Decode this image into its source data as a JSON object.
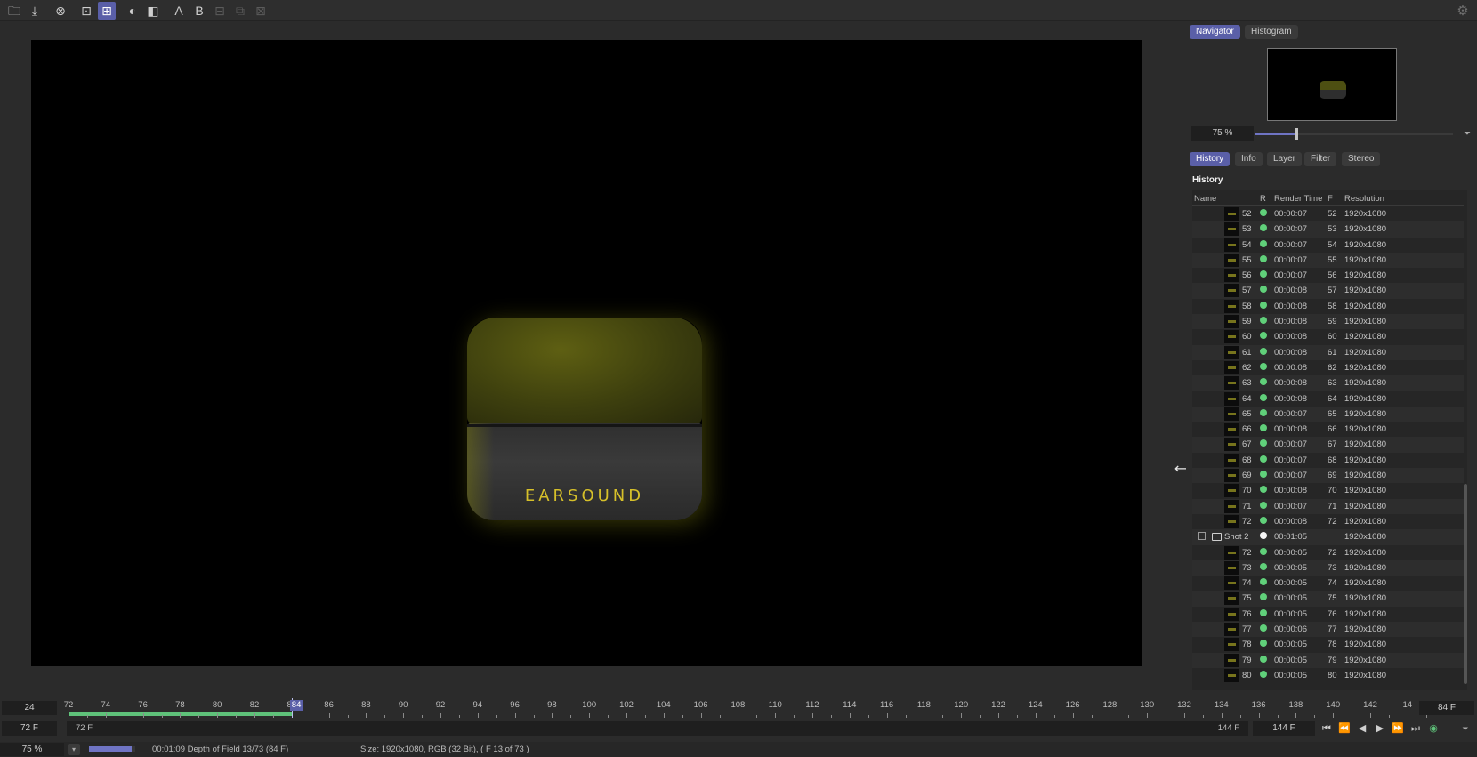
{
  "toolbar": {
    "buttons": [
      {
        "name": "open-folder-icon",
        "glyph": "🗀",
        "active": false,
        "dim": false
      },
      {
        "name": "save-icon",
        "glyph": "⤓",
        "active": false,
        "dim": false
      },
      {
        "name": "close-circle-icon",
        "glyph": "⊗",
        "active": false,
        "dim": false
      },
      {
        "name": "render-region-icon",
        "glyph": "⊡",
        "active": false,
        "dim": false
      },
      {
        "name": "render-active-icon",
        "glyph": "⊞",
        "active": true,
        "dim": false
      },
      {
        "name": "contrast-icon",
        "glyph": "◐",
        "active": false,
        "dim": false
      },
      {
        "name": "ab-compare-icon",
        "glyph": "◧",
        "active": false,
        "dim": false
      },
      {
        "name": "a-letter-icon",
        "glyph": "A",
        "active": false,
        "dim": false
      },
      {
        "name": "b-letter-icon",
        "glyph": "B",
        "active": false,
        "dim": false
      },
      {
        "name": "split-view-icon",
        "glyph": "⊟",
        "active": false,
        "dim": true
      },
      {
        "name": "layer-copy-icon",
        "glyph": "⧉",
        "active": false,
        "dim": true
      },
      {
        "name": "export-icon",
        "glyph": "⊠",
        "active": false,
        "dim": true
      }
    ],
    "settings_glyph": "⚙"
  },
  "viewport": {
    "product_logo": "EARSOUND",
    "cursor_glyph": "⟷"
  },
  "panel": {
    "top_tabs": [
      "Navigator",
      "Histogram"
    ],
    "zoom": "75 %",
    "zoom_fraction": 0.2,
    "zoom_menu_glyph": "⏷",
    "tabs": [
      "History",
      "Info",
      "Layer",
      "Filter",
      "Stereo"
    ],
    "history_title": "History",
    "columns": {
      "name": "Name",
      "r": "R",
      "render_time": "Render Time",
      "f": "F",
      "resolution": "Resolution"
    },
    "rows": [
      {
        "name": "52",
        "time": "00:00:07",
        "f": "52",
        "res": "1920x1080"
      },
      {
        "name": "53",
        "time": "00:00:07",
        "f": "53",
        "res": "1920x1080"
      },
      {
        "name": "54",
        "time": "00:00:07",
        "f": "54",
        "res": "1920x1080"
      },
      {
        "name": "55",
        "time": "00:00:07",
        "f": "55",
        "res": "1920x1080"
      },
      {
        "name": "56",
        "time": "00:00:07",
        "f": "56",
        "res": "1920x1080"
      },
      {
        "name": "57",
        "time": "00:00:08",
        "f": "57",
        "res": "1920x1080"
      },
      {
        "name": "58",
        "time": "00:00:08",
        "f": "58",
        "res": "1920x1080"
      },
      {
        "name": "59",
        "time": "00:00:08",
        "f": "59",
        "res": "1920x1080"
      },
      {
        "name": "60",
        "time": "00:00:08",
        "f": "60",
        "res": "1920x1080"
      },
      {
        "name": "61",
        "time": "00:00:08",
        "f": "61",
        "res": "1920x1080"
      },
      {
        "name": "62",
        "time": "00:00:08",
        "f": "62",
        "res": "1920x1080"
      },
      {
        "name": "63",
        "time": "00:00:08",
        "f": "63",
        "res": "1920x1080"
      },
      {
        "name": "64",
        "time": "00:00:08",
        "f": "64",
        "res": "1920x1080"
      },
      {
        "name": "65",
        "time": "00:00:07",
        "f": "65",
        "res": "1920x1080"
      },
      {
        "name": "66",
        "time": "00:00:08",
        "f": "66",
        "res": "1920x1080"
      },
      {
        "name": "67",
        "time": "00:00:07",
        "f": "67",
        "res": "1920x1080"
      },
      {
        "name": "68",
        "time": "00:00:07",
        "f": "68",
        "res": "1920x1080"
      },
      {
        "name": "69",
        "time": "00:00:07",
        "f": "69",
        "res": "1920x1080"
      },
      {
        "name": "70",
        "time": "00:00:08",
        "f": "70",
        "res": "1920x1080"
      },
      {
        "name": "71",
        "time": "00:00:07",
        "f": "71",
        "res": "1920x1080"
      },
      {
        "name": "72",
        "time": "00:00:08",
        "f": "72",
        "res": "1920x1080"
      },
      {
        "name": "Shot 2",
        "time": "00:01:05",
        "f": "",
        "res": "1920x1080",
        "folder": true
      },
      {
        "name": "72",
        "time": "00:00:05",
        "f": "72",
        "res": "1920x1080"
      },
      {
        "name": "73",
        "time": "00:00:05",
        "f": "73",
        "res": "1920x1080"
      },
      {
        "name": "74",
        "time": "00:00:05",
        "f": "74",
        "res": "1920x1080"
      },
      {
        "name": "75",
        "time": "00:00:05",
        "f": "75",
        "res": "1920x1080"
      },
      {
        "name": "76",
        "time": "00:00:05",
        "f": "76",
        "res": "1920x1080"
      },
      {
        "name": "77",
        "time": "00:00:06",
        "f": "77",
        "res": "1920x1080"
      },
      {
        "name": "78",
        "time": "00:00:05",
        "f": "78",
        "res": "1920x1080"
      },
      {
        "name": "79",
        "time": "00:00:05",
        "f": "79",
        "res": "1920x1080"
      },
      {
        "name": "80",
        "time": "00:00:05",
        "f": "80",
        "res": "1920x1080"
      }
    ]
  },
  "timeline": {
    "fps": "24",
    "start_field": "72 F",
    "end_field_right": "84 F",
    "range_start_label": "72 F",
    "range_end_label": "144 F",
    "end_frame_field": "144 F",
    "ticks": [
      "72",
      "74",
      "76",
      "78",
      "80",
      "82",
      "84",
      "86",
      "88",
      "90",
      "92",
      "94",
      "96",
      "98",
      "100",
      "102",
      "104",
      "106",
      "108",
      "110",
      "112",
      "114",
      "116",
      "118",
      "120",
      "122",
      "124",
      "126",
      "128",
      "130",
      "132",
      "134",
      "136",
      "138",
      "140",
      "142",
      "14"
    ],
    "current_frame": "84",
    "rendered_until": 84,
    "frame_min": 72,
    "frame_max": 144,
    "transport": [
      {
        "name": "skip-start-icon",
        "glyph": "⏮"
      },
      {
        "name": "step-back-icon",
        "glyph": "⏪"
      },
      {
        "name": "play-reverse-icon",
        "glyph": "◀"
      },
      {
        "name": "play-icon",
        "glyph": "▶"
      },
      {
        "name": "step-forward-icon",
        "glyph": "⏩"
      },
      {
        "name": "skip-end-icon",
        "glyph": "⏭"
      },
      {
        "name": "record-icon",
        "glyph": "◉"
      }
    ],
    "menu_glyph": "⏷"
  },
  "status": {
    "zoom": "75 %",
    "dropdown_glyph": "▾",
    "progress_fraction": 0.92,
    "render_info": "00:01:09 Depth of Field 13/73 (84 F)",
    "size_info": "Size: 1920x1080, RGB (32 Bit),  ( F 13 of 73 )"
  },
  "colors": {
    "accent": "#5a5fa8",
    "success": "#60d07a",
    "logo": "#d6c02a"
  }
}
